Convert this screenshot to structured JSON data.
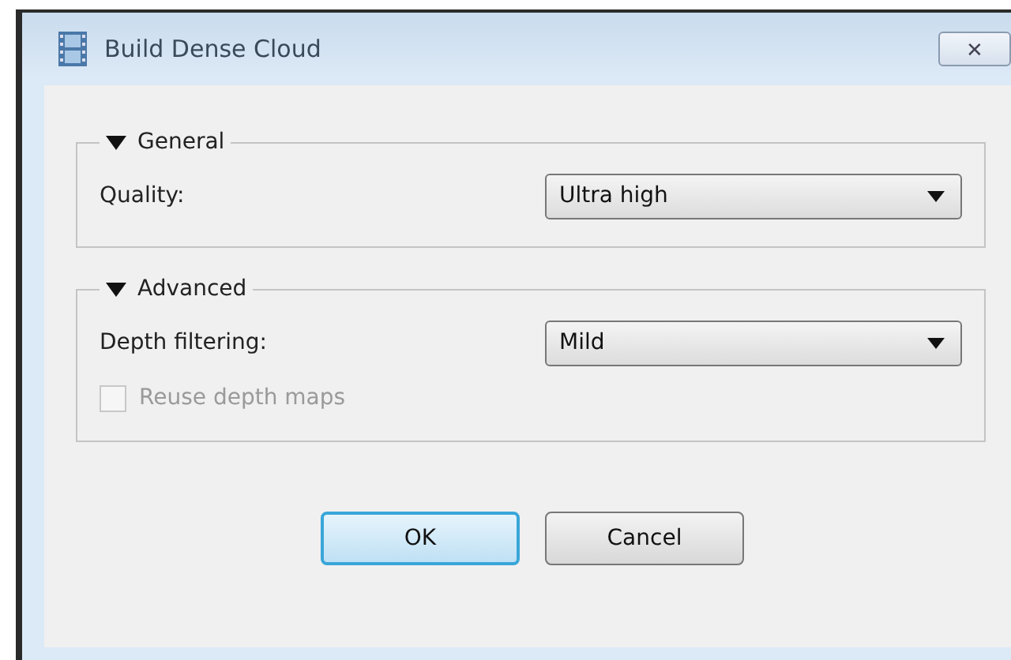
{
  "window": {
    "title": "Build Dense Cloud",
    "close": "✕"
  },
  "groups": [
    {
      "title": "General",
      "expanded": true,
      "fields": [
        {
          "label": "Quality:",
          "value": "Ultra high"
        }
      ]
    },
    {
      "title": "Advanced",
      "expanded": true,
      "fields": [
        {
          "label": "Depth filtering:",
          "value": "Mild"
        }
      ],
      "checkbox": {
        "label": "Reuse depth maps",
        "checked": false,
        "disabled": true
      }
    }
  ],
  "buttons": [
    {
      "label": "OK",
      "default": true
    },
    {
      "label": "Cancel",
      "default": false
    }
  ]
}
